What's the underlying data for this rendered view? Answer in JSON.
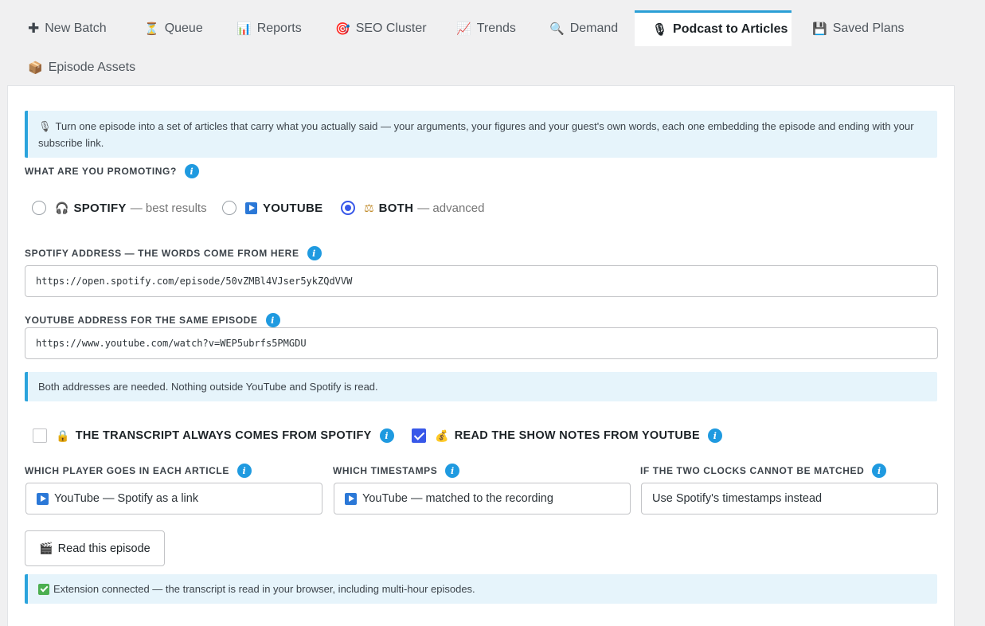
{
  "tabs": [
    {
      "id": "new-batch",
      "icon": "plus-icon",
      "icon_glyph": "✚",
      "label": "New Batch"
    },
    {
      "id": "queue",
      "icon": "hourglass-icon",
      "icon_glyph": "⏳",
      "label": "Queue"
    },
    {
      "id": "reports",
      "icon": "bar-chart-icon",
      "icon_glyph": "📊",
      "label": "Reports"
    },
    {
      "id": "seo-cluster",
      "icon": "target-icon",
      "icon_glyph": "🎯",
      "label": "SEO Cluster"
    },
    {
      "id": "trends",
      "icon": "trend-chart-icon",
      "icon_glyph": "📈",
      "label": "Trends"
    },
    {
      "id": "demand",
      "icon": "magnifier-icon",
      "icon_glyph": "🔍",
      "label": "Demand"
    },
    {
      "id": "podcast-to-articles",
      "icon": "microphone-icon",
      "icon_glyph": "🎙",
      "label": "Podcast to Articles",
      "active": true
    },
    {
      "id": "saved-plans",
      "icon": "floppy-disk-icon",
      "icon_glyph": "💾",
      "label": "Saved Plans"
    },
    {
      "id": "episode-assets",
      "icon": "package-icon",
      "icon_glyph": "📦",
      "label": "Episode Assets"
    }
  ],
  "intro": {
    "icon": "microphone-icon",
    "text": "Turn one episode into a set of articles that carry what you actually said — your arguments, your figures and your guest's own words, each one embedding the episode and ending with your subscribe link."
  },
  "promote": {
    "label": "WHAT ARE YOU PROMOTING?",
    "selected": "both",
    "options": [
      {
        "id": "spotify",
        "icon": "headphones-icon",
        "icon_glyph": "🎧",
        "name": "SPOTIFY",
        "hint": "— best results"
      },
      {
        "id": "youtube",
        "icon": "play-button-icon",
        "name": "YOUTUBE",
        "hint": ""
      },
      {
        "id": "both",
        "icon": "balance-scale-icon",
        "icon_glyph": "⚖",
        "name": "BOTH",
        "hint": "— advanced"
      }
    ]
  },
  "spotify_field": {
    "label": "SPOTIFY ADDRESS — THE WORDS COME FROM HERE",
    "value": "https://open.spotify.com/episode/50vZMBl4VJser5ykZQdVVW"
  },
  "youtube_field": {
    "label": "YOUTUBE ADDRESS FOR THE SAME EPISODE",
    "value": "https://www.youtube.com/watch?v=WEP5ubrfs5PMGDU"
  },
  "both_notice": "Both addresses are needed. Nothing outside YouTube and Spotify is read.",
  "transcript_check": {
    "icon": "lock-icon",
    "icon_glyph": "🔒",
    "label": "THE TRANSCRIPT ALWAYS COMES FROM SPOTIFY",
    "checked": false
  },
  "shownotes_check": {
    "icon": "money-bag-icon",
    "icon_glyph": "💰",
    "label": "READ THE SHOW NOTES FROM YOUTUBE",
    "checked": true
  },
  "player_select": {
    "label": "WHICH PLAYER GOES IN EACH ARTICLE",
    "value": "YouTube — Spotify as a link"
  },
  "timestamps_select": {
    "label": "WHICH TIMESTAMPS",
    "value": "YouTube — matched to the recording"
  },
  "clocks_select": {
    "label": "IF THE TWO CLOCKS CANNOT BE MATCHED",
    "value": "Use Spotify's timestamps instead"
  },
  "read_button": {
    "icon": "clapperboard-icon",
    "icon_glyph": "🎬",
    "label": "Read this episode"
  },
  "status": {
    "icon": "check-mark-icon",
    "text": "Extension connected — the transcript is read in your browser, including multi-hour episodes."
  },
  "colors": {
    "accent": "#2a9fd6",
    "radio_selected": "#3858e9",
    "info": "#1f9ae0",
    "notice_bg": "#e6f4fb"
  }
}
